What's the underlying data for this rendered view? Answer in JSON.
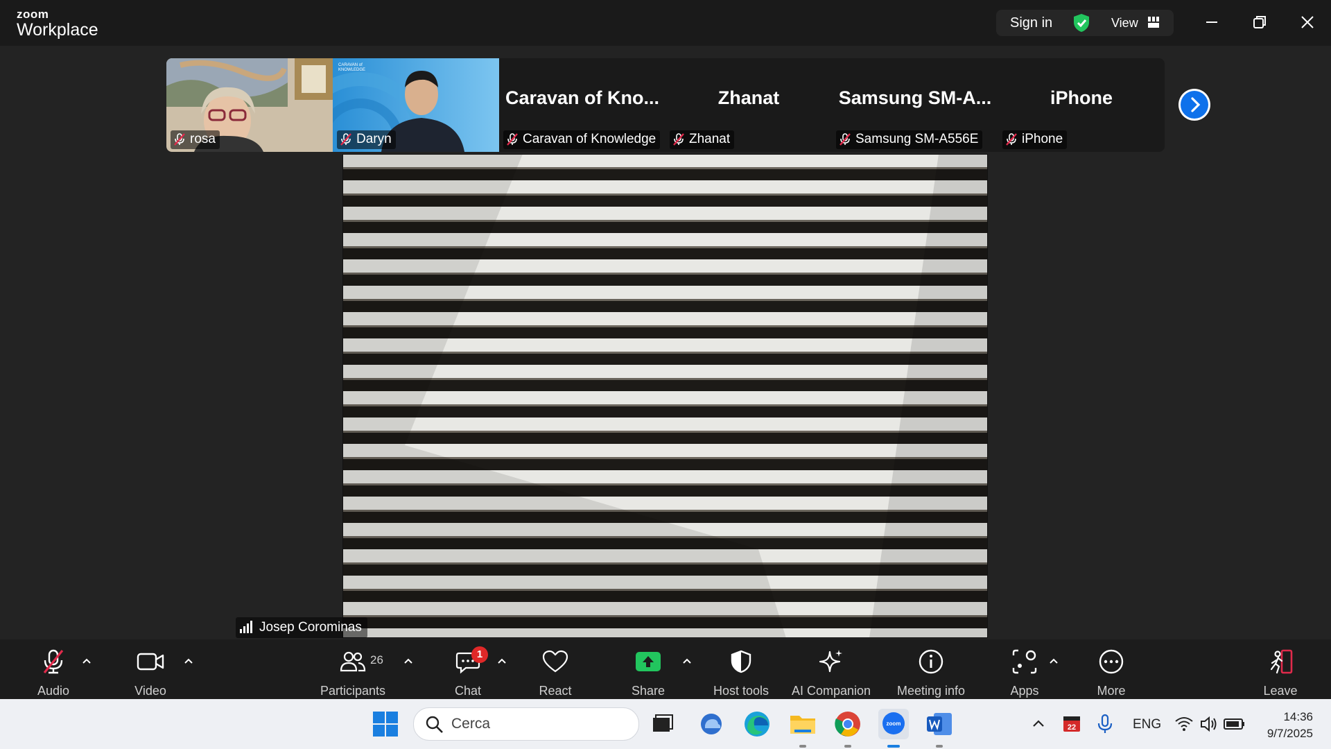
{
  "app": {
    "brand_top": "zoom",
    "brand_bottom": "Workplace"
  },
  "titlebar": {
    "sign_in": "Sign in",
    "view": "View",
    "icons": [
      "shield-check-icon",
      "grid-icon",
      "minimize-icon",
      "restore-icon",
      "close-icon"
    ]
  },
  "gallery": {
    "tiles": [
      {
        "caption": "rosa",
        "display_name": "",
        "muted": true,
        "kind": "video"
      },
      {
        "caption": "Daryn",
        "display_name": "",
        "muted": true,
        "kind": "video",
        "overlay_text": "CARAVAN of KNOWLEDGE"
      },
      {
        "caption": "Caravan of Knowledge",
        "display_name": "Caravan of Kno...",
        "muted": true,
        "kind": "name"
      },
      {
        "caption": "Zhanat",
        "display_name": "Zhanat",
        "muted": true,
        "kind": "name"
      },
      {
        "caption": "Samsung SM-A556E",
        "display_name": "Samsung SM-A...",
        "muted": true,
        "kind": "name"
      },
      {
        "caption": "iPhone",
        "display_name": "iPhone",
        "muted": true,
        "kind": "name"
      }
    ]
  },
  "main_video": {
    "speaker": "Josep Corominas"
  },
  "toolbar": {
    "audio": "Audio",
    "video": "Video",
    "participants": "Participants",
    "participants_count": "26",
    "chat": "Chat",
    "chat_badge": "1",
    "react": "React",
    "share": "Share",
    "host_tools": "Host tools",
    "ai_companion": "AI Companion",
    "meeting_info": "Meeting info",
    "apps": "Apps",
    "more": "More",
    "leave": "Leave"
  },
  "colors": {
    "accent": "#0e71eb",
    "share_green": "#22c55e",
    "mute_red": "#e02a4b",
    "badge_red": "#e02828"
  },
  "taskbar": {
    "search_placeholder": "Cerca",
    "language": "ENG",
    "time": "14:36",
    "date": "9/7/2025",
    "calendar_day": "22"
  }
}
